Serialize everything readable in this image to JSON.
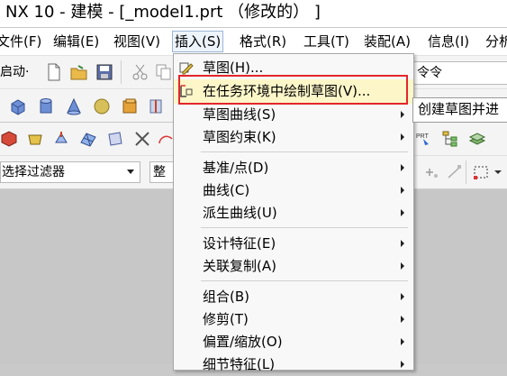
{
  "window": {
    "title": "NX 10 - 建模 - [_model1.prt （修改的） ]"
  },
  "menubar": {
    "items": [
      {
        "label": "文件(F)"
      },
      {
        "label": "编辑(E)"
      },
      {
        "label": "视图(V)"
      },
      {
        "label": "插入(S)"
      },
      {
        "label": "格式(R)"
      },
      {
        "label": "工具(T)"
      },
      {
        "label": "装配(A)"
      },
      {
        "label": "信息(I)"
      },
      {
        "label": "分析"
      }
    ]
  },
  "toolbar": {
    "start_label": "启动·",
    "selection_filter": "选择过滤器",
    "scope": "整个",
    "command_search": "令令"
  },
  "insert_menu": {
    "items": [
      {
        "label": "草图(H)...",
        "has_submenu": false
      },
      {
        "label": "在任务环境中绘制草图(V)...",
        "has_submenu": false
      },
      {
        "label": "草图曲线(S)",
        "has_submenu": true
      },
      {
        "label": "草图约束(K)",
        "has_submenu": true
      },
      {
        "label": "基准/点(D)",
        "has_submenu": true
      },
      {
        "label": "曲线(C)",
        "has_submenu": true
      },
      {
        "label": "派生曲线(U)",
        "has_submenu": true
      },
      {
        "label": "设计特征(E)",
        "has_submenu": true
      },
      {
        "label": "关联复制(A)",
        "has_submenu": true
      },
      {
        "label": "组合(B)",
        "has_submenu": true
      },
      {
        "label": "修剪(T)",
        "has_submenu": true
      },
      {
        "label": "偏置/缩放(O)",
        "has_submenu": true
      },
      {
        "label": "细节特征(L)",
        "has_submenu": true
      }
    ]
  },
  "tooltip": {
    "text": "创建草图并进"
  },
  "colors": {
    "highlight_frame": "#e3262b",
    "hover_item": "#fdf6c9",
    "graphics_background": "#c7c7c7"
  }
}
